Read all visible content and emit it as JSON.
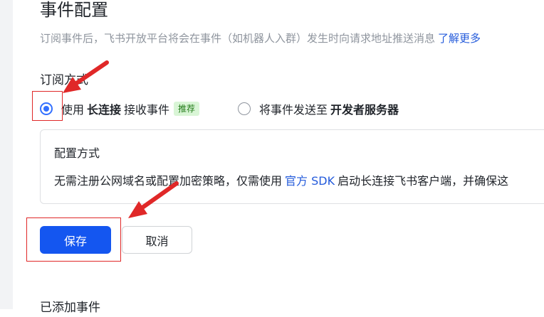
{
  "page": {
    "title": "事件配置",
    "description": "订阅事件后，飞书开放平台将会在事件（如机器人入群）发生时向请求地址推送消息",
    "learn_more": "了解更多"
  },
  "subscription": {
    "label": "订阅方式",
    "option_long_conn": {
      "prefix": "使用",
      "strong": "长连接",
      "suffix": "接收事件",
      "badge": "推荐",
      "selected": true
    },
    "option_server": {
      "prefix": "将事件发送至",
      "strong": "开发者服务器",
      "selected": false
    }
  },
  "config_card": {
    "title": "配置方式",
    "text_before": "无需注册公网域名或配置加密策略，仅需使用",
    "link": "官方 SDK",
    "text_after": "启动长连接飞书客户端，并确保这"
  },
  "actions": {
    "save": "保存",
    "cancel": "取消"
  },
  "next_section": {
    "title": "已添加事件"
  },
  "colors": {
    "accent": "#3370ff",
    "primary_button": "#1456f0",
    "annotation_red": "#e02828",
    "badge_bg": "#d9f5d6",
    "badge_text": "#237b19"
  }
}
